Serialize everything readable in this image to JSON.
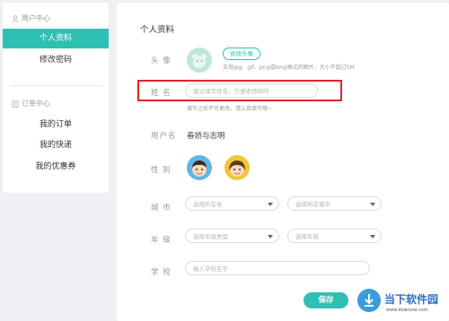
{
  "sidebar": {
    "user_center_heading": "用户中心",
    "user_items": [
      "个人资料",
      "修改密码"
    ],
    "order_center_heading": "订单中心",
    "order_items": [
      "我的订单",
      "我的快递",
      "我的优惠券"
    ]
  },
  "panel": {
    "title": "个人资料",
    "avatar": {
      "label": "头 像",
      "change_button": "修改头像",
      "hint": "支持jpg、gif、png或bmp格式的图片，大小不超过5M"
    },
    "name": {
      "label": "姓 名",
      "placeholder": "建议填写姓名，方便老师称呼",
      "hint": "填写之后不可更改，请认真填写哦~"
    },
    "username": {
      "label": "用户名",
      "value": "春娇与志明"
    },
    "gender": {
      "label": "性 别"
    },
    "city": {
      "label": "城 市",
      "province_placeholder": "选择所在省",
      "city_placeholder": "选择所在城市"
    },
    "grade": {
      "label": "年 级",
      "type_placeholder": "选择年级类型",
      "grade_placeholder": "选择年级"
    },
    "school": {
      "label": "学 校",
      "placeholder": "输入学校名字"
    },
    "save_button": "保存"
  },
  "watermark": {
    "text": "当下软件园",
    "url": "www.downxia.com"
  },
  "colors": {
    "accent": "#2fc0b4",
    "highlight": "#e0262b"
  }
}
